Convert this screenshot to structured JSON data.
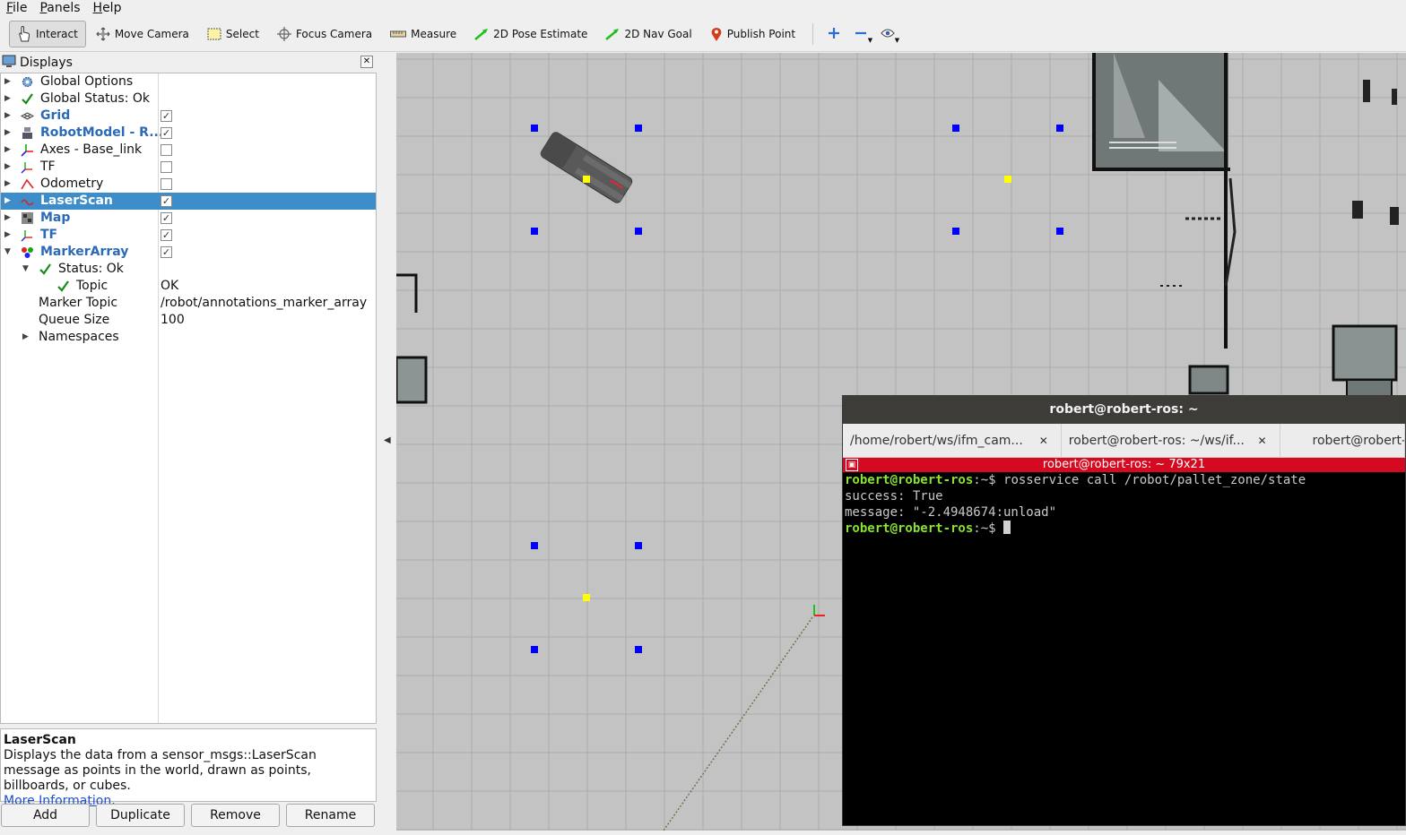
{
  "menubar": {
    "items": [
      "File",
      "Panels",
      "Help"
    ]
  },
  "toolbar": {
    "tools": [
      {
        "label": "Interact",
        "icon": "hand-pointer-icon",
        "active": true
      },
      {
        "label": "Move Camera",
        "icon": "move-camera-icon",
        "active": false
      },
      {
        "label": "Select",
        "icon": "select-rectangle-icon",
        "active": false
      },
      {
        "label": "Focus Camera",
        "icon": "crosshair-icon",
        "active": false
      },
      {
        "label": "Measure",
        "icon": "ruler-icon",
        "active": false
      },
      {
        "label": "2D Pose Estimate",
        "icon": "green-arrow-icon",
        "active": false
      },
      {
        "label": "2D Nav Goal",
        "icon": "green-arrow-icon",
        "active": false
      },
      {
        "label": "Publish Point",
        "icon": "map-pin-icon",
        "active": false
      }
    ],
    "extra_icons": [
      "plus-icon",
      "minus-icon",
      "eye-icon"
    ]
  },
  "displays": {
    "title": "Displays",
    "rows": [
      {
        "label": "Global Options",
        "icon": "gear-icon",
        "indent": 0,
        "expander": "collapsed",
        "blue": false,
        "checkbox": null,
        "value": ""
      },
      {
        "label": "Global Status: Ok",
        "icon": "check-icon",
        "indent": 0,
        "expander": "collapsed",
        "blue": false,
        "checkbox": null,
        "value": ""
      },
      {
        "label": "Grid",
        "icon": "grid-icon",
        "indent": 0,
        "expander": "collapsed",
        "blue": true,
        "checkbox": true,
        "value": ""
      },
      {
        "label": "RobotModel - R...",
        "icon": "robot-model-icon",
        "indent": 0,
        "expander": "collapsed",
        "blue": true,
        "checkbox": true,
        "value": ""
      },
      {
        "label": "Axes - Base_link",
        "icon": "axes-icon",
        "indent": 0,
        "expander": "collapsed",
        "blue": false,
        "checkbox": false,
        "value": ""
      },
      {
        "label": "TF",
        "icon": "tf-icon",
        "indent": 0,
        "expander": "collapsed",
        "blue": false,
        "checkbox": false,
        "value": ""
      },
      {
        "label": "Odometry",
        "icon": "odometry-icon",
        "indent": 0,
        "expander": "collapsed",
        "blue": false,
        "checkbox": false,
        "value": ""
      },
      {
        "label": "LaserScan",
        "icon": "laserscan-icon",
        "indent": 0,
        "expander": "collapsed",
        "blue": true,
        "checkbox": true,
        "value": "",
        "selected": true
      },
      {
        "label": "Map",
        "icon": "map-icon",
        "indent": 0,
        "expander": "collapsed",
        "blue": true,
        "checkbox": true,
        "value": ""
      },
      {
        "label": "TF",
        "icon": "tf-icon",
        "indent": 0,
        "expander": "collapsed",
        "blue": true,
        "checkbox": true,
        "value": ""
      },
      {
        "label": "MarkerArray",
        "icon": "marker-array-icon",
        "indent": 0,
        "expander": "expanded",
        "blue": true,
        "checkbox": true,
        "value": ""
      },
      {
        "label": "Status: Ok",
        "icon": "check-icon",
        "indent": 1,
        "expander": "expanded",
        "blue": false,
        "checkbox": null,
        "value": ""
      },
      {
        "label": "Topic",
        "icon": "check-icon",
        "indent": 2,
        "expander": "none",
        "blue": false,
        "checkbox": null,
        "value": "OK"
      },
      {
        "label": "Marker Topic",
        "icon": "",
        "indent": 1,
        "expander": "none",
        "blue": false,
        "checkbox": null,
        "value": "/robot/annotations_marker_array"
      },
      {
        "label": "Queue Size",
        "icon": "",
        "indent": 1,
        "expander": "none",
        "blue": false,
        "checkbox": null,
        "value": "100"
      },
      {
        "label": "Namespaces",
        "icon": "",
        "indent": 1,
        "expander": "collapsed",
        "blue": false,
        "checkbox": null,
        "value": ""
      }
    ]
  },
  "description": {
    "title": "LaserScan",
    "text": "Displays the data from a sensor_msgs::LaserScan message as points in the world, drawn as points, billboards, or cubes.",
    "link": "More Information",
    "link_suffix": "."
  },
  "buttons": {
    "add": "Add",
    "duplicate": "Duplicate",
    "remove": "Remove",
    "rename": "Rename"
  },
  "terminal": {
    "window_title": "robert@robert-ros: ~",
    "tabs": [
      {
        "label": "/home/robert/ws/ifm_cam..."
      },
      {
        "label": "robert@robert-ros: ~/ws/if..."
      },
      {
        "label": "robert@robert-"
      }
    ],
    "session_bar": "robert@robert-ros: ~ 79x21",
    "lines": [
      {
        "prompt": "robert@robert-ros",
        "suffix": ":~$ ",
        "text": "rosservice call /robot/pallet_zone/state"
      },
      {
        "prompt": "",
        "suffix": "",
        "text": "success: True"
      },
      {
        "prompt": "",
        "suffix": "",
        "text": "message: \"-2.4948674:unload\""
      },
      {
        "prompt": "robert@robert-ros",
        "suffix": ":~$ ",
        "text": "",
        "cursor": true
      }
    ]
  },
  "colors": {
    "selection": "#3c8dc9",
    "blue_label": "#2a6ab8",
    "viewport_bg": "#c3c3c3",
    "grid_line": "#ababab",
    "marker_blue": "#0000ff",
    "marker_yellow": "#ffff00",
    "terminal_red_bar": "#d5091f",
    "prompt_green": "#8ae234"
  }
}
